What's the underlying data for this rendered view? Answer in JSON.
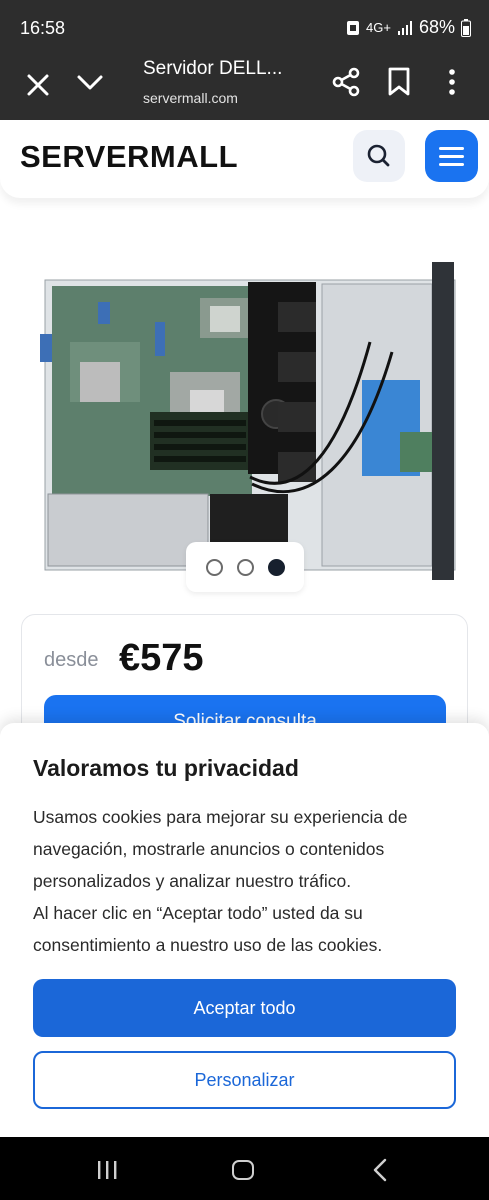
{
  "status_bar": {
    "time": "16:58",
    "battery": "68%",
    "network": "4G+",
    "icons": [
      "notification-icon",
      "signal-icon",
      "battery-icon"
    ]
  },
  "browser": {
    "page_title": "Servidor DELL...",
    "url": "servermall.com",
    "icons": [
      "close-icon",
      "chevron-down-icon",
      "share-icon",
      "bookmark-icon",
      "more-vert-icon"
    ]
  },
  "site": {
    "logo": "SERVERMALL",
    "accent_color": "#1a73f0",
    "icons": [
      "search-icon",
      "hamburger-menu-icon"
    ]
  },
  "product": {
    "image_alt": "server-motherboard-photo",
    "carousel_total": 3,
    "carousel_active": 3
  },
  "price": {
    "from_label": "desde",
    "value": "€575",
    "consult_label": "Solicitar consulta"
  },
  "cookie": {
    "title": "Valoramos tu privacidad",
    "text_1": "Usamos cookies para mejorar su experiencia de navegación, mostrarle anuncios o contenidos personalizados y analizar nuestro tráfico.",
    "text_2": "Al hacer clic en “Aceptar todo” usted da su consentimiento a nuestro uso de las cookies.",
    "accept_label": "Aceptar todo",
    "customize_label": "Personalizar",
    "button_color": "#1b67d8"
  },
  "nav": {
    "icons": [
      "recent-apps-icon",
      "home-icon",
      "back-icon"
    ]
  }
}
